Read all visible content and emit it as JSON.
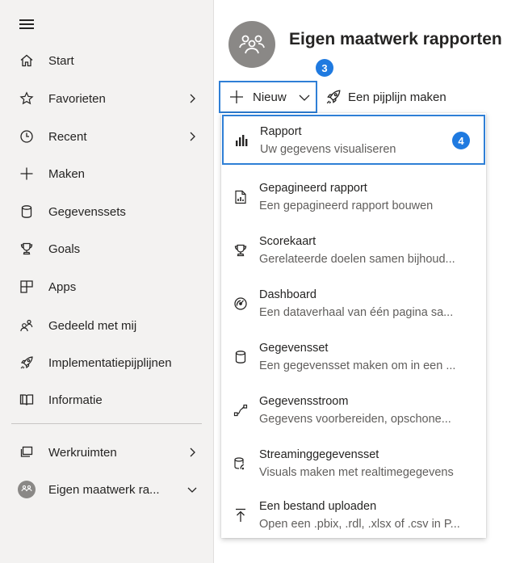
{
  "sidebar": {
    "items": [
      {
        "label": "Start",
        "icon": "home-icon"
      },
      {
        "label": "Favorieten",
        "icon": "star-icon"
      },
      {
        "label": "Recent",
        "icon": "clock-icon"
      },
      {
        "label": "Maken",
        "icon": "plus-icon"
      },
      {
        "label": "Gegevenssets",
        "icon": "database-icon"
      },
      {
        "label": "Goals",
        "icon": "trophy-icon"
      },
      {
        "label": "Apps",
        "icon": "apps-icon"
      },
      {
        "label": "Gedeeld met mij",
        "icon": "shared-icon"
      },
      {
        "label": "Implementatiepijplijnen",
        "icon": "rocket-icon"
      },
      {
        "label": "Informatie",
        "icon": "book-icon"
      }
    ],
    "workspaces_label": "Werkruimten",
    "current_workspace": "Eigen maatwerk ra..."
  },
  "header": {
    "title": "Eigen maatwerk rapporten"
  },
  "toolbar": {
    "new_label": "Nieuw",
    "pipeline_label": "Een pijplijn maken",
    "step_badge": "3"
  },
  "menu": {
    "step_badge": "4",
    "items": [
      {
        "title": "Rapport",
        "desc": "Uw gegevens visualiseren",
        "icon": "bar-chart-icon"
      },
      {
        "title": "Gepagineerd rapport",
        "desc": "Een gepagineerd rapport bouwen",
        "icon": "paginated-report-icon"
      },
      {
        "title": "Scorekaart",
        "desc": "Gerelateerde doelen samen bijhoud...",
        "icon": "trophy-icon"
      },
      {
        "title": "Dashboard",
        "desc": "Een dataverhaal van één pagina sa...",
        "icon": "gauge-icon"
      },
      {
        "title": "Gegevensset",
        "desc": "Een gegevensset maken om in een ...",
        "icon": "database-icon"
      },
      {
        "title": "Gegevensstroom",
        "desc": "Gegevens voorbereiden, opschone...",
        "icon": "dataflow-icon"
      },
      {
        "title": "Streaminggegevensset",
        "desc": "Visuals maken met realtimegegevens",
        "icon": "streaming-icon"
      },
      {
        "title": "Een bestand uploaden",
        "desc": "Open een .pbix, .rdl, .xlsx of .csv in P...",
        "icon": "upload-icon"
      }
    ]
  },
  "colors": {
    "accent": "#2f7fd6",
    "badge": "#1f7ae0",
    "sidebar_bg": "#f3f2f1",
    "avatar": "#8a8886"
  }
}
